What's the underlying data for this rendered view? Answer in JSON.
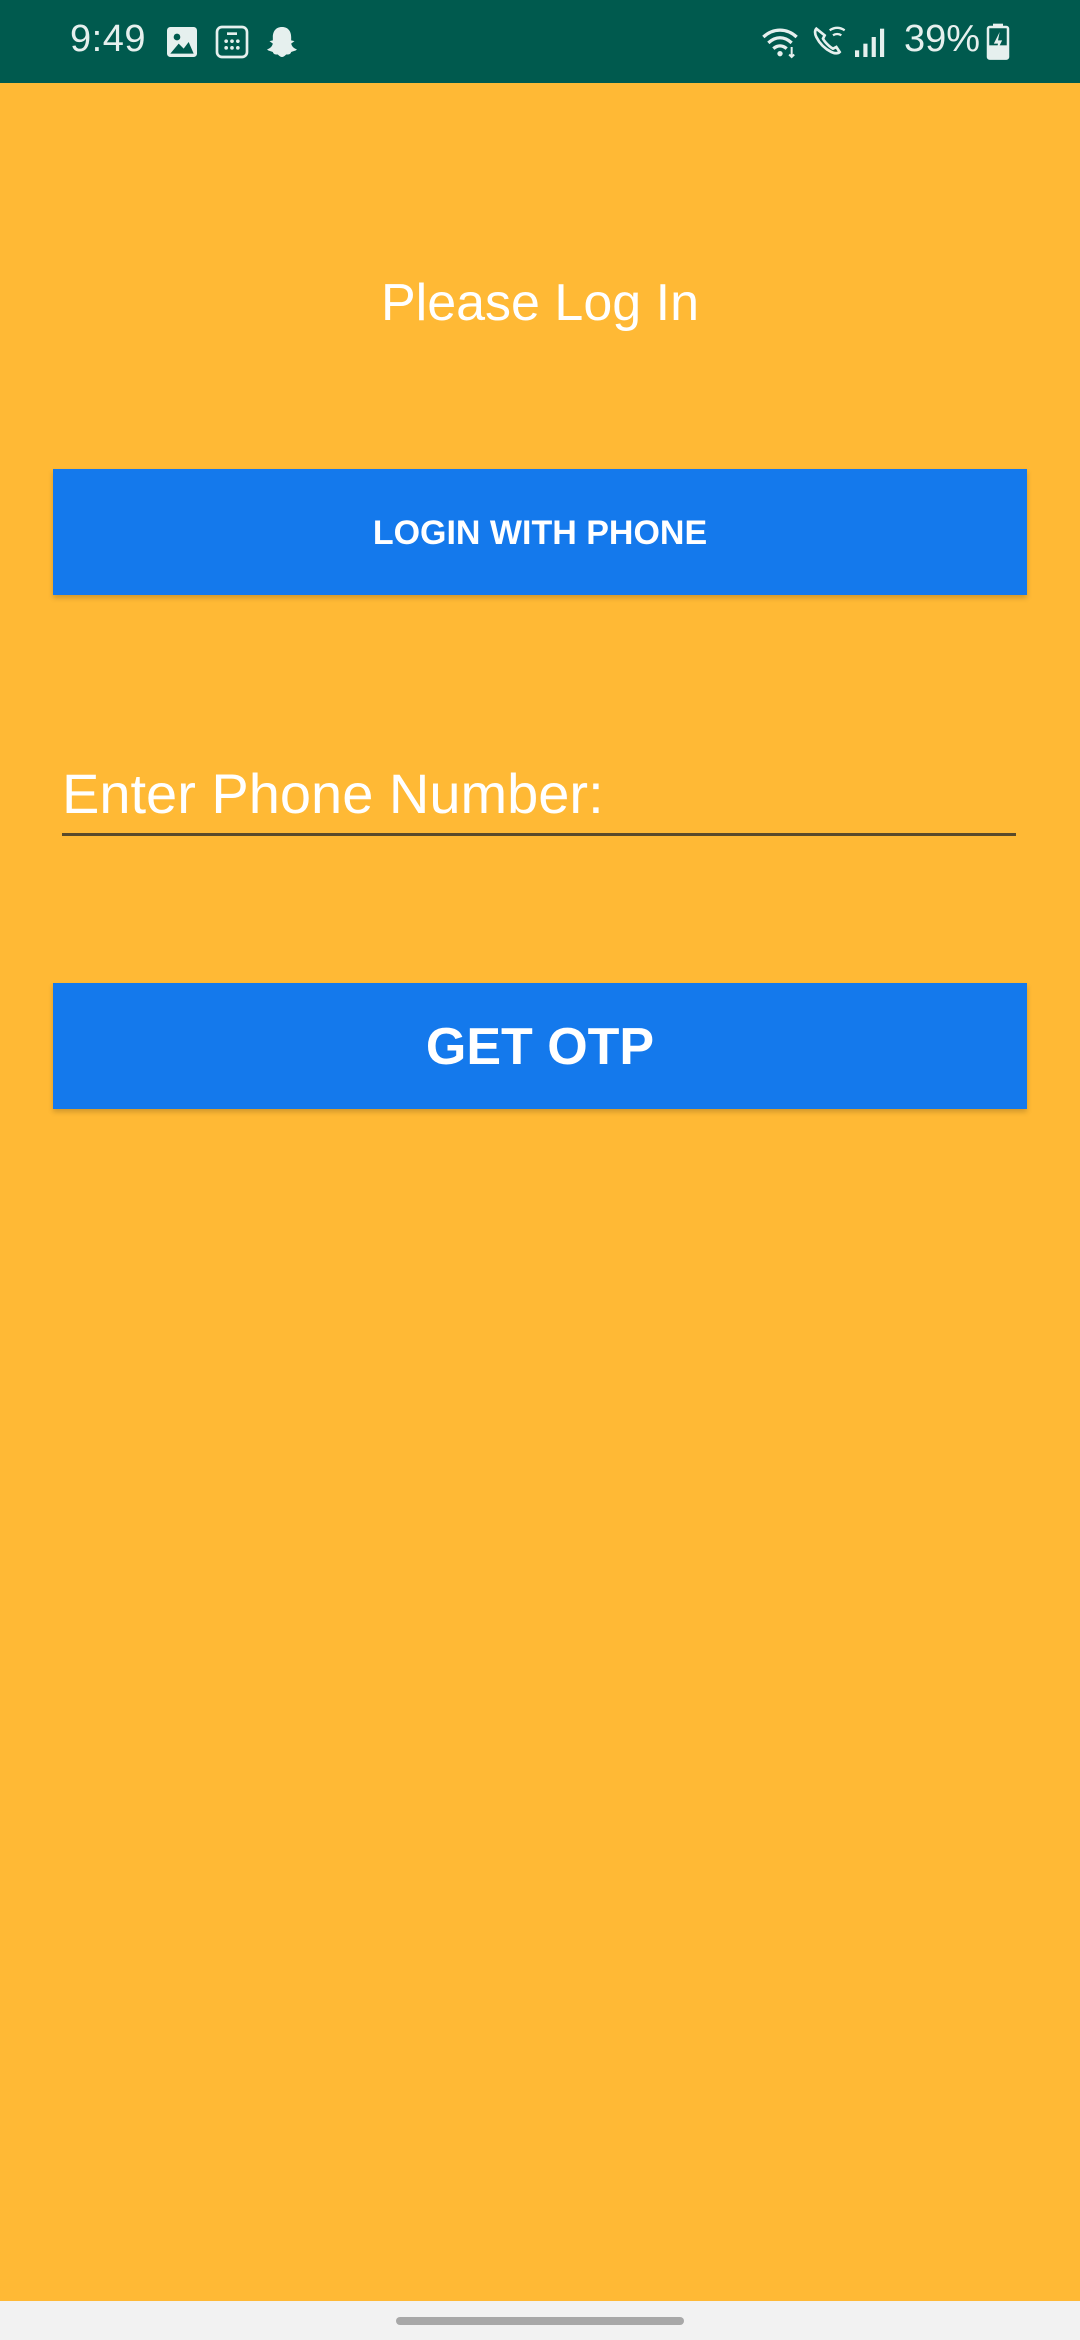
{
  "status_bar": {
    "time": "9:49",
    "battery": "39%",
    "icons": [
      "image-icon",
      "calculator-icon",
      "snapchat-ghost-icon",
      "wifi-icon",
      "wifi-calling-icon",
      "signal-icon",
      "battery-charging-icon"
    ]
  },
  "login": {
    "title": "Please Log In",
    "login_button_label": "LOGIN WITH PHONE",
    "phone_placeholder": "Enter Phone Number:",
    "phone_value": "",
    "otp_button_label": "GET OTP"
  },
  "colors": {
    "status_bar": "#005A4E",
    "background": "#FFB935",
    "button": "#1479EC",
    "text": "#FFFFFF"
  }
}
